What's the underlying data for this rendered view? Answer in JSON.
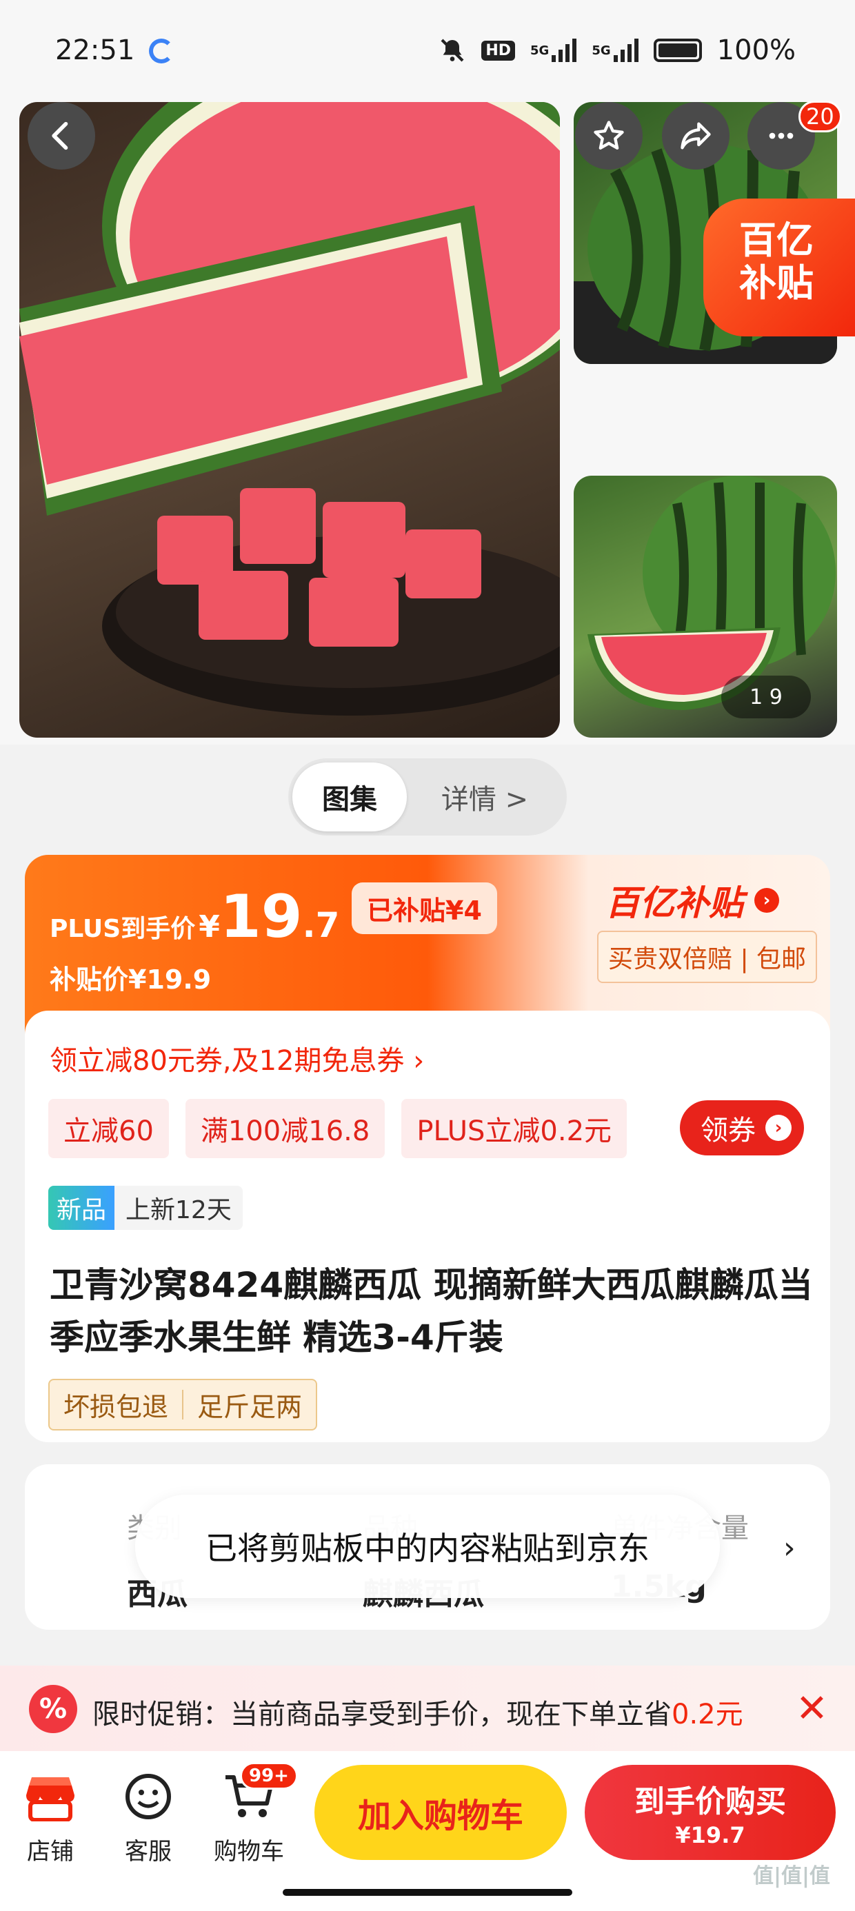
{
  "status_bar": {
    "time": "22:51",
    "battery": "100%",
    "hd_label": "HD",
    "net1": "5G",
    "net2": "5G"
  },
  "nav": {
    "more_badge": "20"
  },
  "gallery": {
    "promo_badge_line1": "百亿",
    "promo_badge_line2": "补贴",
    "counter": "1 9"
  },
  "tabs": {
    "active": "图集",
    "other": "详情 >"
  },
  "price": {
    "plus_label": "PLUS到手价",
    "yen": "¥",
    "integer": "19",
    "decimal": ".7",
    "subsidy_badge": "已补贴¥4",
    "sub_price": "补贴价¥19.9",
    "brand": "百亿补贴",
    "brand_arrow": "›",
    "guarantee": "买贵双倍赔 | 包邮"
  },
  "coupons": {
    "link": "领立减80元券,及12期免息券 ›",
    "chips": [
      "立减60",
      "满100减16.8",
      "PLUS立减0.2元"
    ],
    "get_label": "领券",
    "get_arrow": "›"
  },
  "new_tag": {
    "label": "新品",
    "text": "上新12天"
  },
  "product": {
    "title": "卫青沙窝8424麒麟西瓜 现摘新鲜大西瓜麒麟瓜当季应季水果生鲜 精选3-4斤装",
    "tags": [
      "坏损包退",
      "足斤足两"
    ]
  },
  "specs": {
    "items": [
      {
        "key": "类别",
        "value": "西瓜"
      },
      {
        "key": "品种",
        "value": "麒麟西瓜"
      },
      {
        "key": "单件净含量",
        "value": "1.5kg"
      }
    ],
    "arrow": "›"
  },
  "toast": "已将剪贴板中的内容粘贴到京东",
  "promo": {
    "icon": "%",
    "text": "限时促销：当前商品享受到手价，现在下单立省",
    "amount": "0.2元",
    "close": "✕"
  },
  "bottom_bar": {
    "tabs": [
      {
        "label": "店铺",
        "icon": "store-icon"
      },
      {
        "label": "客服",
        "icon": "chat-icon"
      },
      {
        "label": "购物车",
        "icon": "cart-icon"
      }
    ],
    "cart_badge": "99+",
    "add_to_cart": "加入购物车",
    "buy_line1": "到手价购买",
    "buy_line2": "¥19.7"
  },
  "watermark": "值|值|值",
  "colors": {
    "accent": "#f2270c",
    "yellow": "#ffd51a",
    "orange": "#ff7a1a"
  }
}
